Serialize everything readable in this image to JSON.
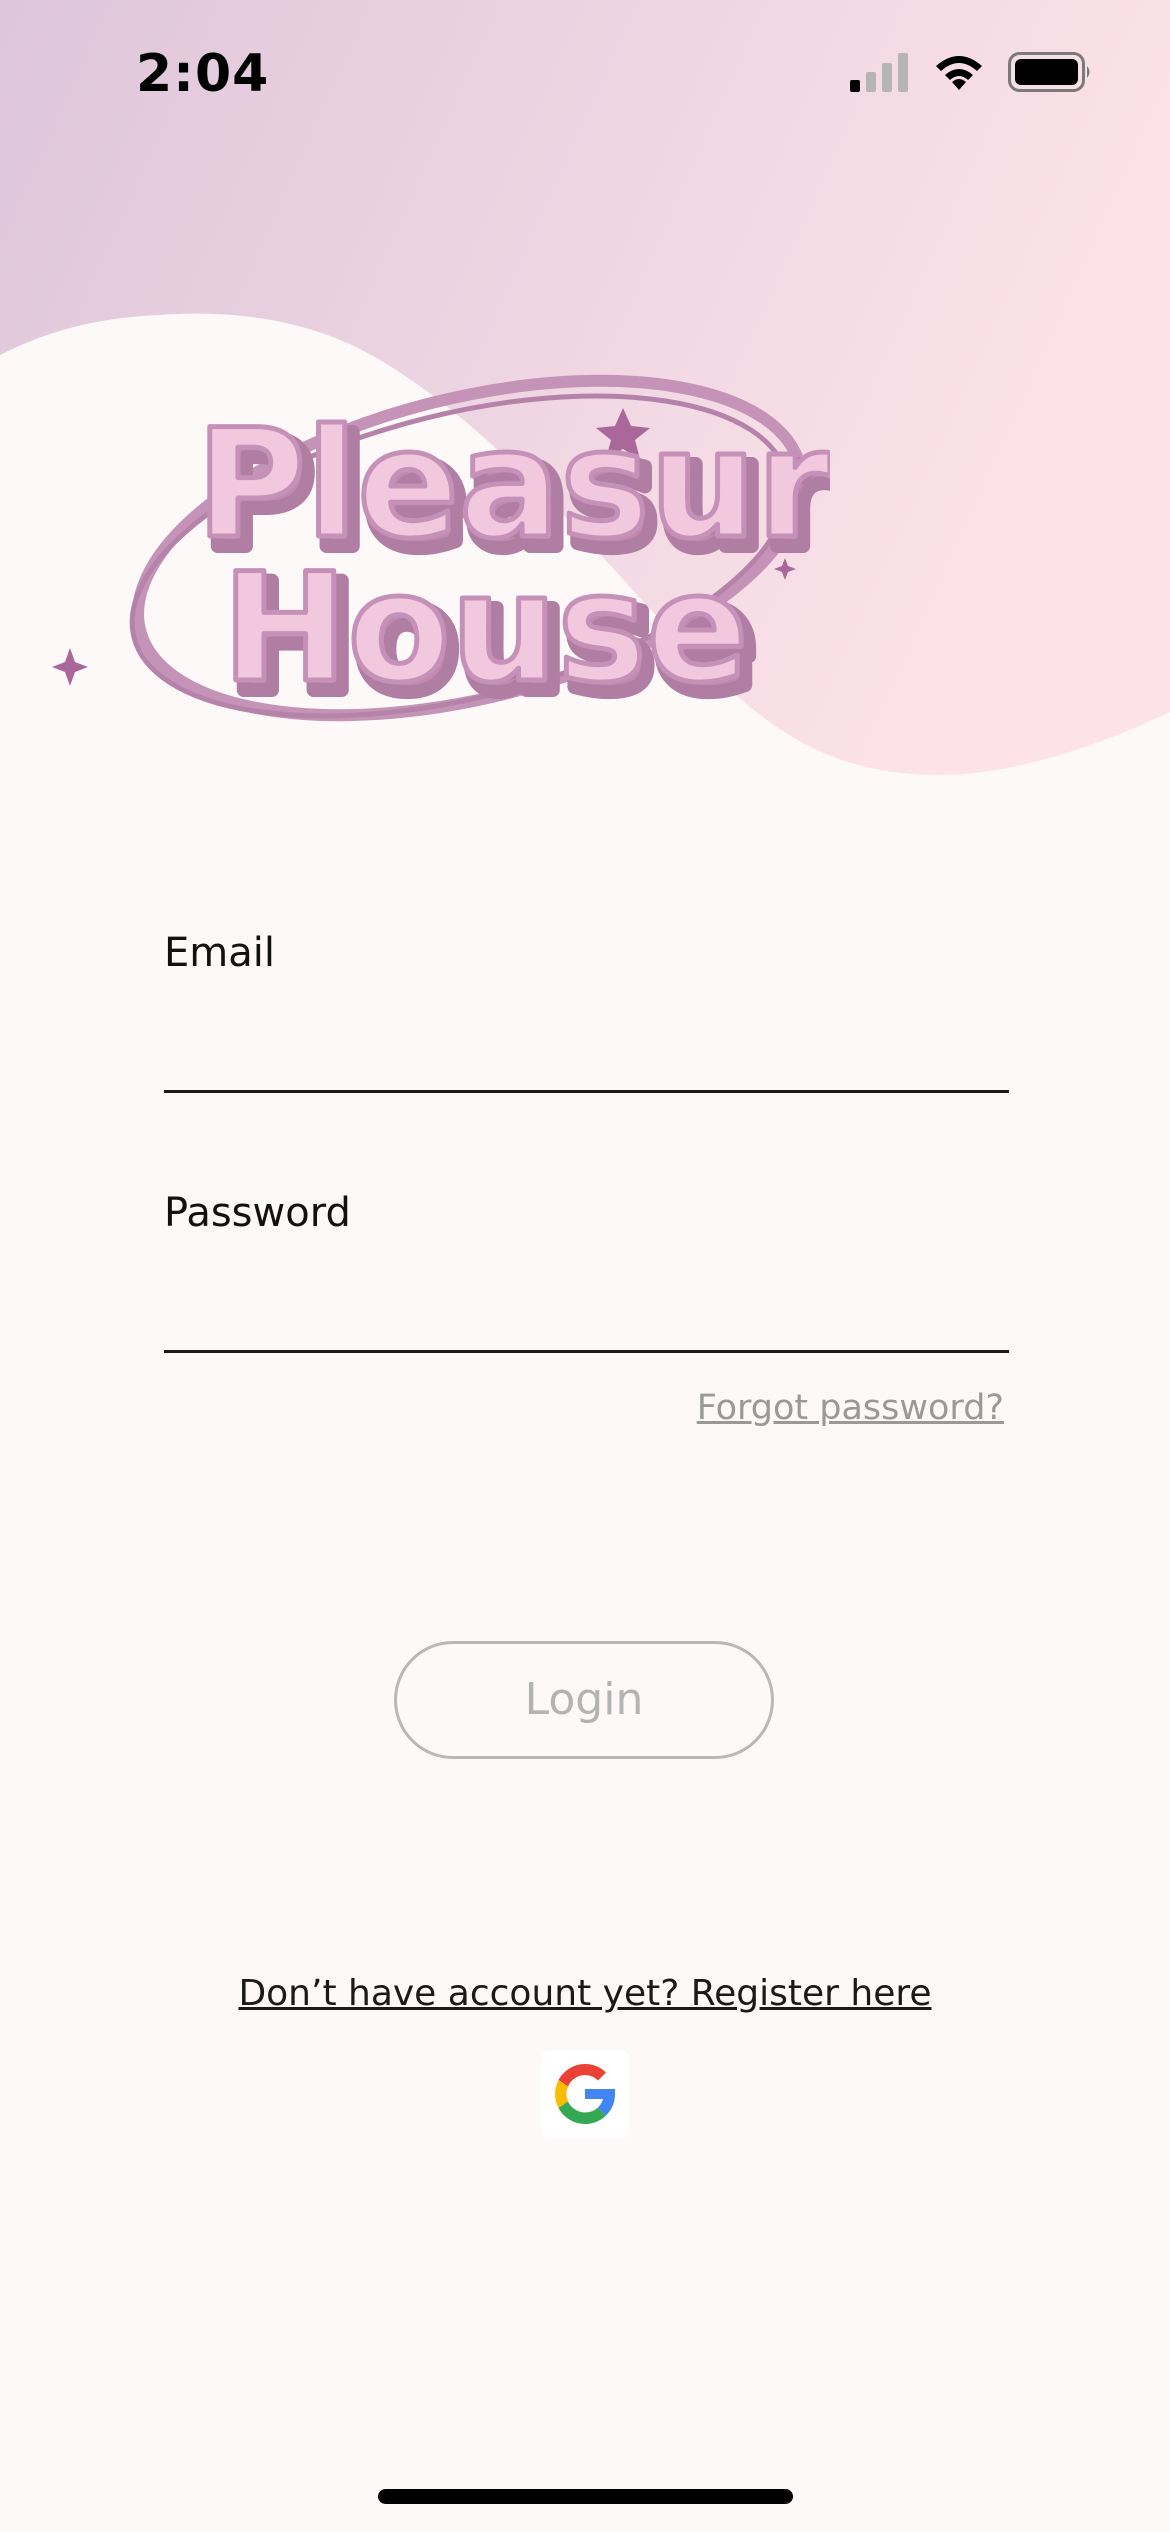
{
  "status_bar": {
    "time": "2:04",
    "icons": [
      "cellular-signal-icon",
      "wifi-icon",
      "battery-icon"
    ]
  },
  "logo": {
    "line1": "Pleasure",
    "line2": "House"
  },
  "form": {
    "email_label": "Email",
    "email_value": "",
    "password_label": "Password",
    "password_value": "",
    "forgot_label": "Forgot password?",
    "login_label": "Login"
  },
  "register": {
    "label": "Don’t have account yet? Register here"
  },
  "social": {
    "google_icon": "google-icon"
  },
  "colors": {
    "background": "#fdf9f8",
    "gradient_start": "#dec6db",
    "gradient_end": "#fde3e8",
    "logo_fill": "#f2c8de",
    "logo_shadow": "#b888ad",
    "accent_purple": "#a9679a"
  }
}
